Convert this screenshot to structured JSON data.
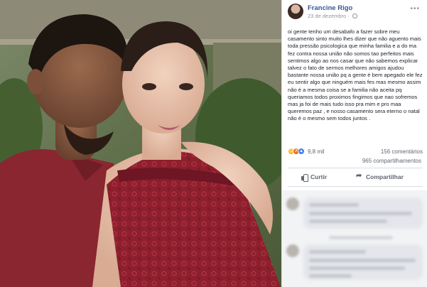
{
  "post": {
    "author": "Francine Rigo",
    "date": "23 de dezembro",
    "text": "oi gente tenho um desabafo a fazer sobre meu casamento sinto muito lhes dizer que não aguento mais toda pressão psicologica que minha familia e a do ma fez contra nossa união não somos tao perfeitos mais sentimos algo ao nos casar que não sabemos explicar talvez o fato de sermos melhores amigos ajudou bastante nossa união pq a gente é bem apegado ele fez eu sentir algo que ninguém mais fes mas mesmo assim não é a mesma coisa se a familia não aceita pq queriamos todos proximos fingimos que nao sofremos mas ja foi de mais tudo isso pra mim e pro maa queremos paz , e nosso casamento sera eterno o natal não é o mesmo sem todos juntos .",
    "reaction_count": "9,8 mil",
    "comment_count": "156 comentários",
    "share_count": "965 compartilhamentos",
    "reactions": [
      "sad-icon",
      "angry-icon",
      "like-icon"
    ]
  },
  "actions": {
    "like_label": "Curtir",
    "share_label": "Compartilhar"
  },
  "icons": {
    "globe": "globe-icon",
    "more": "more-options-icon"
  },
  "colors": {
    "author_link": "#365899",
    "meta_text": "#90949c",
    "body_text": "#1d2129",
    "dress": "#8e1f2d",
    "shirt": "#8a2630"
  }
}
